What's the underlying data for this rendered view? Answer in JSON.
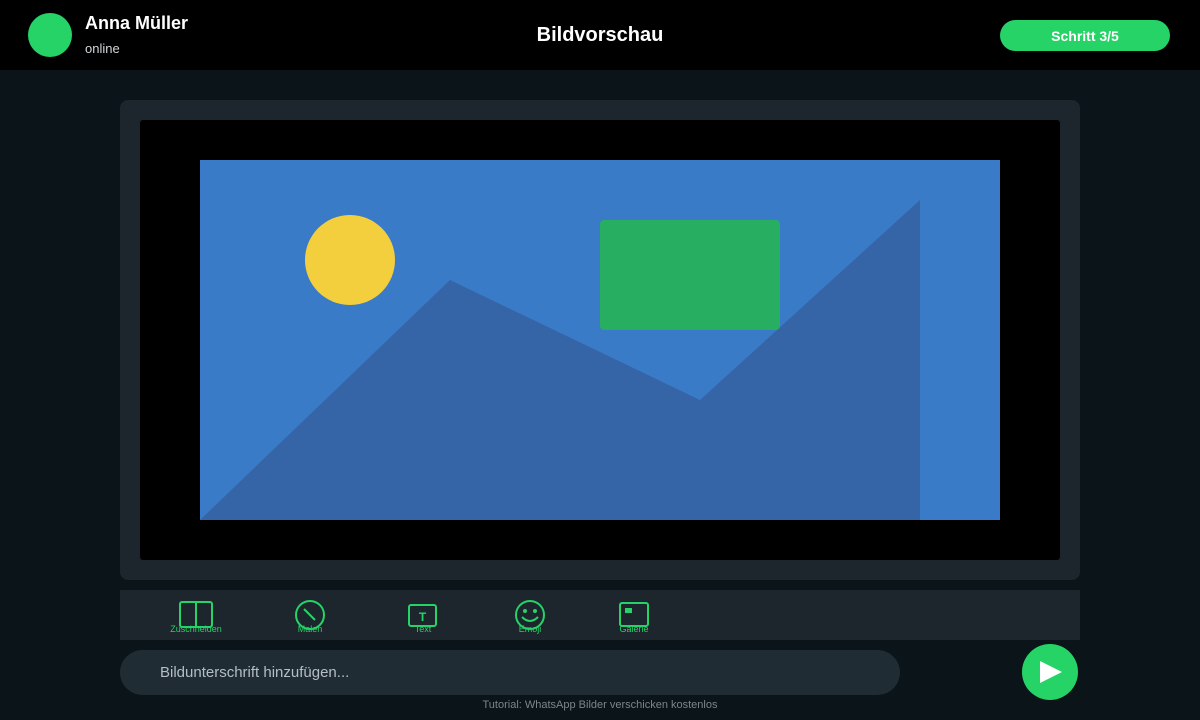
{
  "header": {
    "contact_name": "Anna Müller",
    "contact_status": "online",
    "title": "Bildvorschau",
    "step_label": "Schritt 3/5",
    "avatar_color": "#25d366"
  },
  "preview": {
    "image_colors": {
      "sky": "#3a7bc8",
      "sun": "#f4cf3d",
      "mountain": "#3565a6",
      "rectangle": "#27ae60"
    }
  },
  "toolbar": {
    "tools": [
      {
        "label": "Zuschneiden",
        "icon": "crop-icon"
      },
      {
        "label": "Malen",
        "icon": "paint-icon"
      },
      {
        "label": "Text",
        "icon": "text-icon"
      },
      {
        "label": "Emoji",
        "icon": "emoji-icon"
      },
      {
        "label": "Galerie",
        "icon": "gallery-icon"
      }
    ]
  },
  "caption": {
    "placeholder": "Bildunterschrift hinzufügen...",
    "value": ""
  },
  "send": {
    "icon": "send-icon"
  },
  "footer": {
    "note": "Tutorial: WhatsApp Bilder verschicken kostenlos"
  },
  "colors": {
    "accent": "#25d366",
    "background": "#0b1418",
    "header": "#000000",
    "panel": "#1c262c"
  }
}
